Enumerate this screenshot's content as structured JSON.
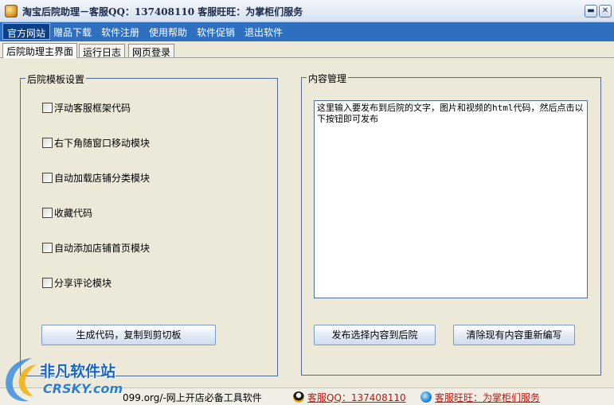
{
  "window": {
    "title": "淘宝后院助理－客服QQ：137408110  客服旺旺：为掌柜们服务",
    "minimize_glyph": "▬",
    "close_glyph": "✕"
  },
  "menu": {
    "items": [
      "官方网站",
      "赠品下载",
      "软件注册",
      "使用帮助",
      "软件促销",
      "退出软件"
    ]
  },
  "tabs": [
    "后院助理主界面",
    "运行日志",
    "网页登录"
  ],
  "left_panel": {
    "legend": "后院模板设置",
    "options": [
      {
        "label": "浮动客服框架代码",
        "checked": false
      },
      {
        "label": "右下角随窗口移动模块",
        "checked": false
      },
      {
        "label": "自动加载店铺分类模块",
        "checked": false
      },
      {
        "label": "收藏代码",
        "checked": false
      },
      {
        "label": "自动添加店铺首页模块",
        "checked": false
      },
      {
        "label": "分享评论模块",
        "checked": false
      }
    ],
    "generate_button": "生成代码，复制到剪切板"
  },
  "right_panel": {
    "legend": "内容管理",
    "content_text": "这里输入要发布到后院的文字，图片和视频的html代码，然后点击以下按钮即可发布",
    "publish_button": "发布选择内容到后院",
    "clear_button": "清除现有内容重新编写"
  },
  "status": {
    "site_text": "099.org/-网上开店必备工具软件",
    "qq_text": "客服QQ：137408110",
    "wangwang_text": "客服旺旺：为掌柜们服务"
  },
  "watermark": {
    "chinese": "非凡软件站",
    "english": "CRSKY.com"
  }
}
